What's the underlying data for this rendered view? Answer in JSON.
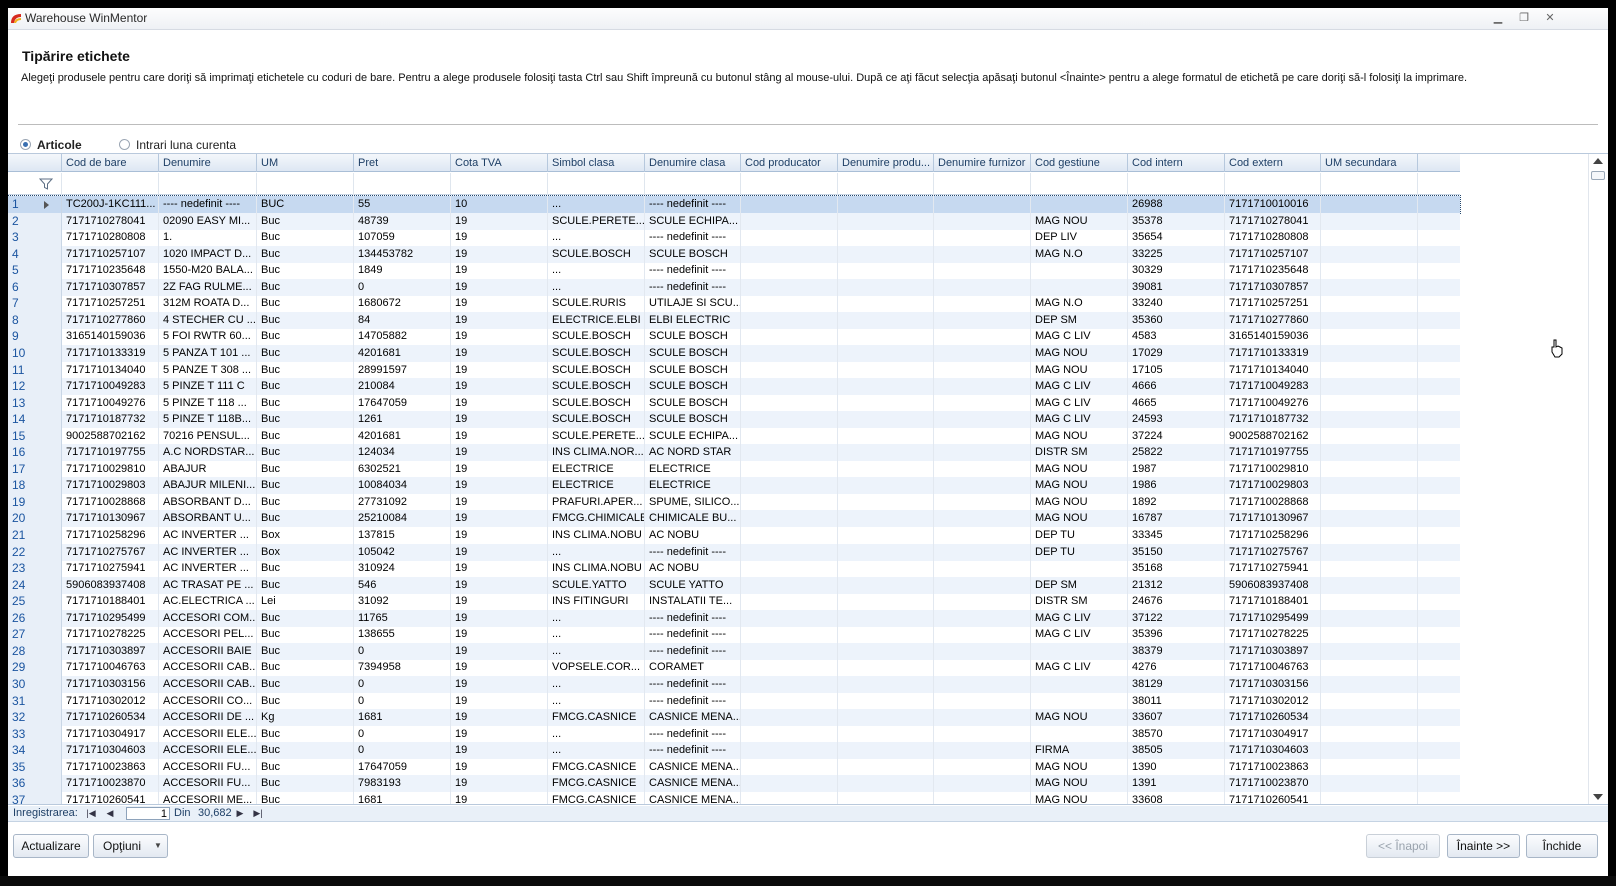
{
  "window": {
    "title": "Warehouse WinMentor",
    "controls": [
      "minimize",
      "restore",
      "close"
    ]
  },
  "page": {
    "heading": "Tipărire etichete",
    "description": "Alegeţi produsele pentru care doriţi să imprimaţi etichetele cu coduri de bare. Pentru a alege produsele folosiţi tasta Ctrl sau Shift împreună cu butonul stâng al mouse-ului. După ce aţi făcut selecţia apăsaţi butonul <Înainte> pentru a alege formatul de etichetă pe care doriţi să-l folosiţi la imprimare."
  },
  "radios": {
    "articole": {
      "label": "Articole",
      "selected": true
    },
    "intrari": {
      "label": "Intrari luna curenta",
      "selected": false
    }
  },
  "columns": [
    "Cod de bare",
    "Denumire",
    "UM",
    "Pret",
    "Cota TVA",
    "Simbol clasa",
    "Denumire clasa",
    "Cod producator",
    "Denumire produ...",
    "Denumire furnizor",
    "Cod gestiune",
    "Cod intern",
    "Cod extern",
    "UM secundara"
  ],
  "rows": [
    [
      "1",
      "TC200J-1KC111...",
      "---- nedefinit ----",
      "BUC",
      "55",
      "10",
      "...",
      "---- nedefinit ----",
      "",
      "",
      "",
      "",
      "26988",
      "7171710010016",
      ""
    ],
    [
      "2",
      "7171710278041",
      "02090 EASY MI...",
      "Buc",
      "48739",
      "19",
      "SCULE.PERETE...",
      "SCULE ECHIPA...",
      "",
      "",
      "",
      "MAG NOU",
      "35378",
      "7171710278041",
      ""
    ],
    [
      "3",
      "7171710280808",
      "1.",
      "Buc",
      "107059",
      "19",
      "...",
      "---- nedefinit ----",
      "",
      "",
      "",
      "DEP LIV",
      "35654",
      "7171710280808",
      ""
    ],
    [
      "4",
      "7171710257107",
      "1020 IMPACT D...",
      "Buc",
      "134453782",
      "19",
      "SCULE.BOSCH",
      "SCULE BOSCH",
      "",
      "",
      "",
      "MAG N.O",
      "33225",
      "7171710257107",
      ""
    ],
    [
      "5",
      "7171710235648",
      "1550-M20 BALA...",
      "Buc",
      "1849",
      "19",
      "...",
      "---- nedefinit ----",
      "",
      "",
      "",
      "",
      "30329",
      "7171710235648",
      ""
    ],
    [
      "6",
      "7171710307857",
      "2Z FAG RULME...",
      "Buc",
      "0",
      "19",
      "...",
      "---- nedefinit ----",
      "",
      "",
      "",
      "",
      "39081",
      "7171710307857",
      ""
    ],
    [
      "7",
      "7171710257251",
      "312M ROATA D...",
      "Buc",
      "1680672",
      "19",
      "SCULE.RURIS",
      "UTILAJE SI SCU...",
      "",
      "",
      "",
      "MAG N.O",
      "33240",
      "7171710257251",
      ""
    ],
    [
      "8",
      "7171710277860",
      "4 STECHER CU ...",
      "Buc",
      "84",
      "19",
      "ELECTRICE.ELBI",
      "ELBI ELECTRIC",
      "",
      "",
      "",
      "DEP SM",
      "35360",
      "7171710277860",
      ""
    ],
    [
      "9",
      "3165140159036",
      "5 FOI RWTR 60...",
      "Buc",
      "14705882",
      "19",
      "SCULE.BOSCH",
      "SCULE BOSCH",
      "",
      "",
      "",
      "MAG C LIV",
      "4583",
      "3165140159036",
      ""
    ],
    [
      "10",
      "7171710133319",
      "5 PANZA T 101 ...",
      "Buc",
      "4201681",
      "19",
      "SCULE.BOSCH",
      "SCULE BOSCH",
      "",
      "",
      "",
      "MAG NOU",
      "17029",
      "7171710133319",
      ""
    ],
    [
      "11",
      "7171710134040",
      "5 PANZE T 308 ...",
      "Buc",
      "28991597",
      "19",
      "SCULE.BOSCH",
      "SCULE BOSCH",
      "",
      "",
      "",
      "MAG NOU",
      "17105",
      "7171710134040",
      ""
    ],
    [
      "12",
      "7171710049283",
      "5 PINZE T 111 C",
      "Buc",
      "210084",
      "19",
      "SCULE.BOSCH",
      "SCULE BOSCH",
      "",
      "",
      "",
      "MAG C LIV",
      "4666",
      "7171710049283",
      ""
    ],
    [
      "13",
      "7171710049276",
      "5 PINZE T 118 ...",
      "Buc",
      "17647059",
      "19",
      "SCULE.BOSCH",
      "SCULE BOSCH",
      "",
      "",
      "",
      "MAG C LIV",
      "4665",
      "7171710049276",
      ""
    ],
    [
      "14",
      "7171710187732",
      "5 PINZE T 118B...",
      "Buc",
      "1261",
      "19",
      "SCULE.BOSCH",
      "SCULE BOSCH",
      "",
      "",
      "",
      "MAG C LIV",
      "24593",
      "7171710187732",
      ""
    ],
    [
      "15",
      "9002588702162",
      "70216 PENSUL...",
      "Buc",
      "4201681",
      "19",
      "SCULE.PERETE...",
      "SCULE ECHIPA...",
      "",
      "",
      "",
      "MAG NOU",
      "37224",
      "9002588702162",
      ""
    ],
    [
      "16",
      "7171710197755",
      "A.C NORDSTAR...",
      "Buc",
      "124034",
      "19",
      "INS CLIMA.NOR...",
      "AC NORD STAR",
      "",
      "",
      "",
      "DISTR SM",
      "25822",
      "7171710197755",
      ""
    ],
    [
      "17",
      "7171710029810",
      "ABAJUR",
      "Buc",
      "6302521",
      "19",
      "ELECTRICE",
      "ELECTRICE",
      "",
      "",
      "",
      "MAG NOU",
      "1987",
      "7171710029810",
      ""
    ],
    [
      "18",
      "7171710029803",
      "ABAJUR MILENI...",
      "Buc",
      "10084034",
      "19",
      "ELECTRICE",
      "ELECTRICE",
      "",
      "",
      "",
      "MAG NOU",
      "1986",
      "7171710029803",
      ""
    ],
    [
      "19",
      "7171710028868",
      "ABSORBANT D...",
      "Buc",
      "27731092",
      "19",
      "PRAFURI.APER...",
      "SPUME, SILICO...",
      "",
      "",
      "",
      "MAG NOU",
      "1892",
      "7171710028868",
      ""
    ],
    [
      "20",
      "7171710130967",
      "ABSORBANT U...",
      "Buc",
      "25210084",
      "19",
      "FMCG.CHIMICALE",
      "CHIMICALE BU...",
      "",
      "",
      "",
      "MAG NOU",
      "16787",
      "7171710130967",
      ""
    ],
    [
      "21",
      "7171710258296",
      "AC INVERTER  ...",
      "Box",
      "137815",
      "19",
      "INS CLIMA.NOBU",
      "AC NOBU",
      "",
      "",
      "",
      "DEP TU",
      "33345",
      "7171710258296",
      ""
    ],
    [
      "22",
      "7171710275767",
      "AC INVERTER  ...",
      "Box",
      "105042",
      "19",
      "...",
      "---- nedefinit ----",
      "",
      "",
      "",
      "DEP TU",
      "35150",
      "7171710275767",
      ""
    ],
    [
      "23",
      "7171710275941",
      "AC INVERTER  ...",
      "Buc",
      "310924",
      "19",
      "INS CLIMA.NOBU",
      "AC NOBU",
      "",
      "",
      "",
      "",
      "35168",
      "7171710275941",
      ""
    ],
    [
      "24",
      "5906083937408",
      "AC TRASAT PE ...",
      "Buc",
      "546",
      "19",
      "SCULE.YATTO",
      "SCULE YATTO",
      "",
      "",
      "",
      "DEP SM",
      "21312",
      "5906083937408",
      ""
    ],
    [
      "25",
      "7171710188401",
      "AC.ELECTRICA ...",
      "Lei",
      "31092",
      "19",
      "INS FITINGURI",
      "INSTALATII TE...",
      "",
      "",
      "",
      "DISTR SM",
      "24676",
      "7171710188401",
      ""
    ],
    [
      "26",
      "7171710295499",
      "ACCESORI COM...",
      "Buc",
      "11765",
      "19",
      "...",
      "---- nedefinit ----",
      "",
      "",
      "",
      "MAG C LIV",
      "37122",
      "7171710295499",
      ""
    ],
    [
      "27",
      "7171710278225",
      "ACCESORI PEL...",
      "Buc",
      "138655",
      "19",
      "...",
      "---- nedefinit ----",
      "",
      "",
      "",
      "MAG C LIV",
      "35396",
      "7171710278225",
      ""
    ],
    [
      "28",
      "7171710303897",
      "ACCESORII BAIE",
      "Buc",
      "0",
      "19",
      "...",
      "---- nedefinit ----",
      "",
      "",
      "",
      "",
      "38379",
      "7171710303897",
      ""
    ],
    [
      "29",
      "7171710046763",
      "ACCESORII CAB...",
      "Buc",
      "7394958",
      "19",
      "VOPSELE.COR...",
      "CORAMET",
      "",
      "",
      "",
      "MAG C LIV",
      "4276",
      "7171710046763",
      ""
    ],
    [
      "30",
      "7171710303156",
      "ACCESORII CAB...",
      "Buc",
      "0",
      "19",
      "...",
      "---- nedefinit ----",
      "",
      "",
      "",
      "",
      "38129",
      "7171710303156",
      ""
    ],
    [
      "31",
      "7171710302012",
      "ACCESORII CO...",
      "Buc",
      "0",
      "19",
      "...",
      "---- nedefinit ----",
      "",
      "",
      "",
      "",
      "38011",
      "7171710302012",
      ""
    ],
    [
      "32",
      "7171710260534",
      "ACCESORII DE ...",
      "Kg",
      "1681",
      "19",
      "FMCG.CASNICE",
      "CASNICE MENA...",
      "",
      "",
      "",
      "MAG NOU",
      "33607",
      "7171710260534",
      ""
    ],
    [
      "33",
      "7171710304917",
      "ACCESORII ELE...",
      "Buc",
      "0",
      "19",
      "...",
      "---- nedefinit ----",
      "",
      "",
      "",
      "",
      "38570",
      "7171710304917",
      ""
    ],
    [
      "34",
      "7171710304603",
      "ACCESORII ELE...",
      "Buc",
      "0",
      "19",
      "...",
      "---- nedefinit ----",
      "",
      "",
      "",
      "FIRMA",
      "38505",
      "7171710304603",
      ""
    ],
    [
      "35",
      "7171710023863",
      "ACCESORII FU...",
      "Buc",
      "17647059",
      "19",
      "FMCG.CASNICE",
      "CASNICE MENA...",
      "",
      "",
      "",
      "MAG NOU",
      "1390",
      "7171710023863",
      ""
    ],
    [
      "36",
      "7171710023870",
      "ACCESORII FU...",
      "Buc",
      "7983193",
      "19",
      "FMCG.CASNICE",
      "CASNICE MENA...",
      "",
      "",
      "",
      "MAG NOU",
      "1391",
      "7171710023870",
      ""
    ],
    [
      "37",
      "7171710260541",
      "ACCESORII ME...",
      "Buc",
      "1681",
      "19",
      "FMCG.CASNICE",
      "CASNICE MENA...",
      "",
      "",
      "",
      "MAG NOU",
      "33608",
      "7171710260541",
      ""
    ]
  ],
  "selected_row": 1,
  "navigator": {
    "label": "Inregistrarea:",
    "current": "1",
    "of_label": "Din",
    "total": "30,682"
  },
  "buttons": {
    "refresh": "Actualizare",
    "options": "Opţiuni",
    "back": "<< Înapoi",
    "next": "Înainte >>",
    "close": "Închide"
  },
  "colors": {
    "header_text": "#1e3f66",
    "selected_row": "#c6d9f0",
    "alt_row": "#edf3fb"
  }
}
